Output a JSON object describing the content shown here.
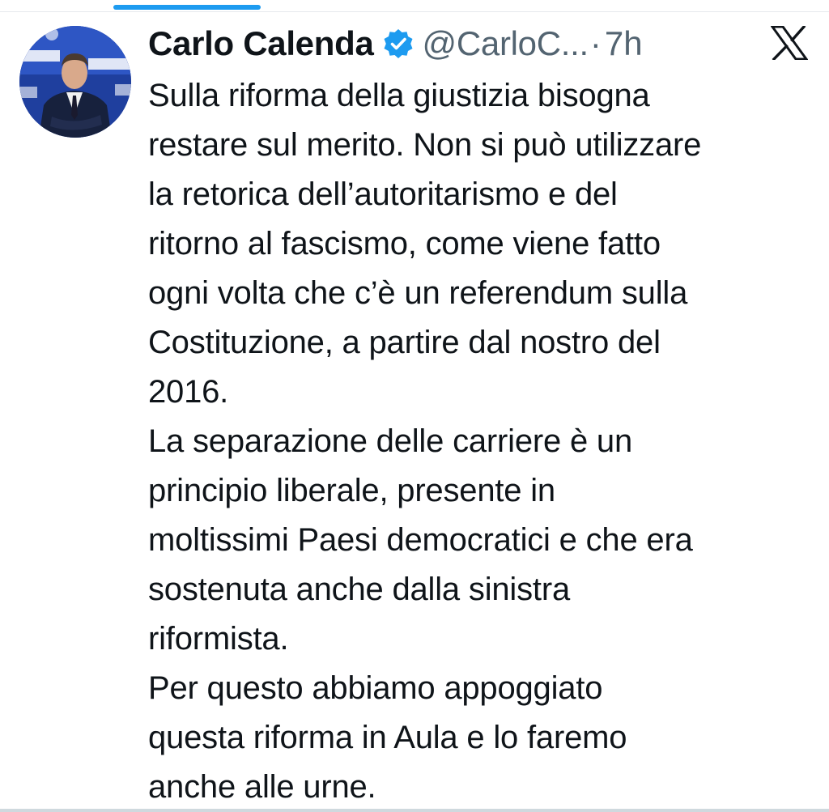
{
  "tweet": {
    "author": {
      "display_name": "Carlo Calenda",
      "handle": "@CarloC...",
      "avatar_icon": "profile-photo",
      "verified_icon": "verified-badge-icon"
    },
    "separator": "·",
    "timestamp": "7h",
    "platform_icon": "x-logo-icon",
    "text_lines": [
      "Sulla riforma della giustizia bisogna",
      "restare sul merito. Non si può utilizzare",
      "la retorica dell’autoritarismo e del",
      "ritorno al fascismo, come viene fatto",
      "ogni volta che c’è un referendum sulla",
      "Costituzione, a partire dal nostro del",
      "2016.",
      "La separazione delle carriere è un",
      "principio liberale, presente in",
      "moltissimi Paesi democratici e che era",
      "sostenuta anche dalla sinistra",
      "riformista.",
      "Per questo abbiamo appoggiato",
      "questa riforma in Aula e lo faremo",
      "anche alle urne."
    ]
  },
  "colors": {
    "accent": "#1d9bf0",
    "text": "#0f1419",
    "muted": "#536471"
  }
}
